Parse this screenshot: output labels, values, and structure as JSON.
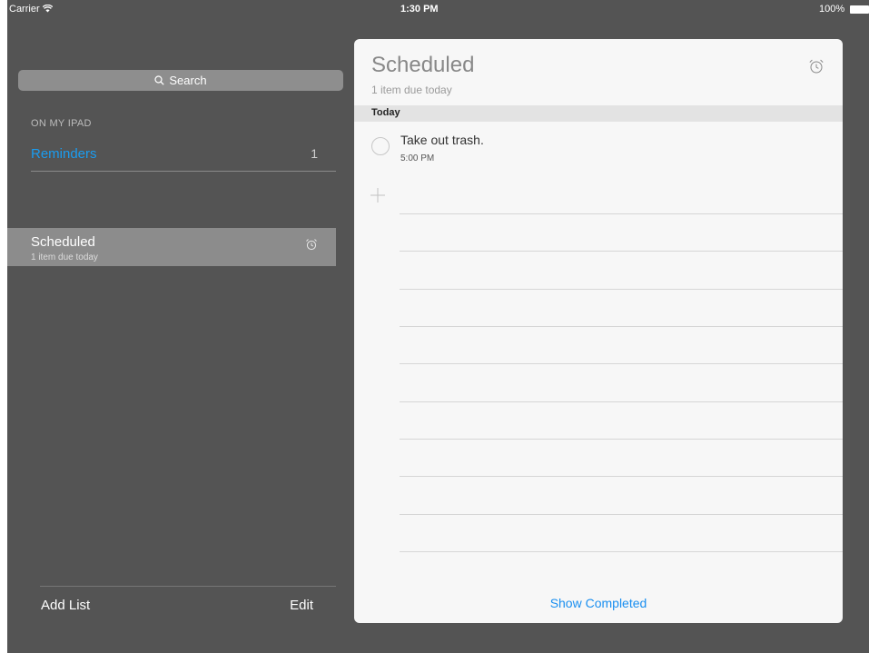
{
  "status_bar": {
    "carrier": "Carrier",
    "time": "1:30 PM",
    "battery": "100%"
  },
  "sidebar": {
    "search_placeholder": "Search",
    "section_header": "ON MY IPAD",
    "lists": [
      {
        "label": "Reminders",
        "count": "1"
      }
    ],
    "scheduled": {
      "title": "Scheduled",
      "subtitle": "1 item due today",
      "icon": "alarm-clock-icon"
    },
    "add_list_label": "Add List",
    "edit_label": "Edit"
  },
  "detail": {
    "title": "Scheduled",
    "subtitle": "1 item due today",
    "icon": "alarm-clock-icon",
    "section_label": "Today",
    "tasks": [
      {
        "text": "Take out trash.",
        "time": "5:00 PM",
        "completed": false
      }
    ],
    "show_completed_label": "Show Completed"
  },
  "colors": {
    "background": "#545454",
    "accent_blue": "#1a9cf0",
    "card_background": "#f7f7f7",
    "selected_row": "#8c8c8c"
  }
}
